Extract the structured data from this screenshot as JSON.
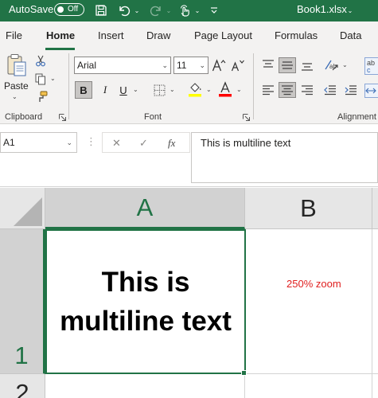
{
  "titlebar": {
    "autosave_label": "AutoSave",
    "autosave_state": "Off",
    "filename": "Book1.xlsx",
    "color": "#217346",
    "icons": [
      "save-icon",
      "undo-icon",
      "redo-icon",
      "touch-mode-icon",
      "customize-qat-icon"
    ]
  },
  "menu": {
    "tabs": [
      "File",
      "Home",
      "Insert",
      "Draw",
      "Page Layout",
      "Formulas",
      "Data"
    ],
    "active": "Home"
  },
  "ribbon": {
    "clipboard": {
      "label": "Clipboard",
      "paste_label": "Paste"
    },
    "font": {
      "label": "Font",
      "font_name": "Arial",
      "font_size": "11",
      "bold_pressed": true,
      "highlight_color": "#ffff00",
      "font_color": "#ff0000"
    },
    "alignment": {
      "label": "Alignment"
    }
  },
  "formula_bar": {
    "name_box": "A1",
    "formula": "This is multiline text",
    "fx_symbol": "fx"
  },
  "grid": {
    "columns": [
      "A",
      "B"
    ],
    "rows": [
      "1",
      "2"
    ],
    "selected_cell": "A1",
    "cells": {
      "A1": "This is multiline text"
    },
    "note": "250% zoom",
    "accent": "#217346"
  }
}
